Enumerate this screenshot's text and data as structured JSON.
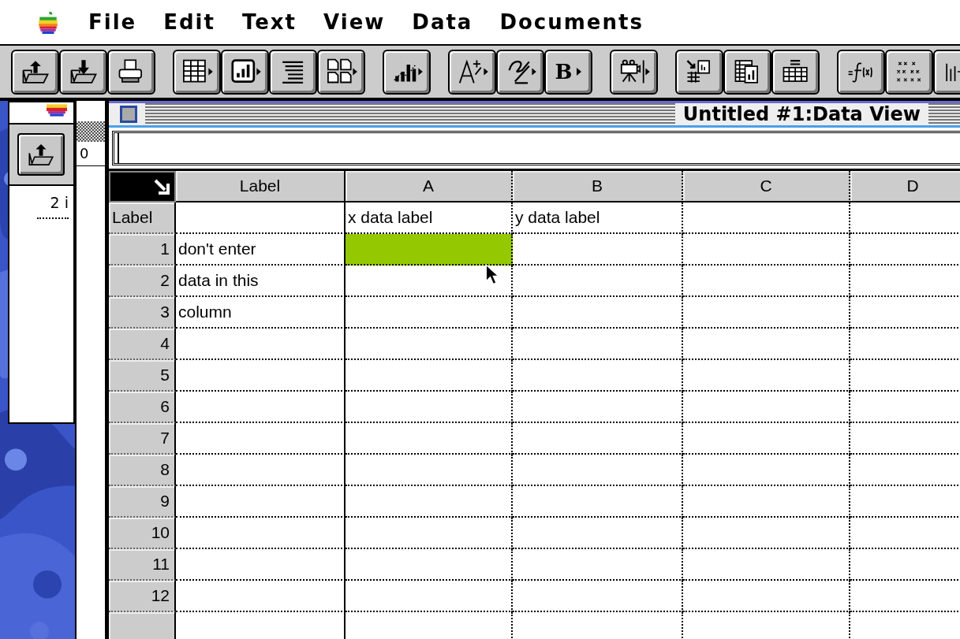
{
  "menu_bar": {
    "items": [
      "File",
      "Edit",
      "Text",
      "View",
      "Data",
      "Documents"
    ]
  },
  "toolbar": {
    "bold_button_label": "B"
  },
  "background_window": {
    "field_value": "0",
    "item_text": "2 i"
  },
  "window": {
    "title": "Untitled #1:Data View"
  },
  "table": {
    "columns": [
      "Label",
      "A",
      "B",
      "C",
      "D"
    ],
    "label_row": {
      "header": "Label",
      "x_label": "x data label",
      "y_label": "y data label"
    },
    "rows": [
      {
        "number": "1",
        "label": "don't enter",
        "cells": [
          {
            "selected": true
          },
          {
            "selected": false
          },
          {
            "selected": false
          },
          {
            "selected": false
          }
        ]
      },
      {
        "number": "2",
        "label": "data in this",
        "cells": [
          {
            "selected": false
          },
          {
            "selected": false
          },
          {
            "selected": false
          },
          {
            "selected": false
          }
        ]
      },
      {
        "number": "3",
        "label": "column",
        "cells": [
          {
            "selected": false
          },
          {
            "selected": false
          },
          {
            "selected": false
          },
          {
            "selected": false
          }
        ]
      },
      {
        "number": "4",
        "cells": [
          {
            "selected": false
          },
          {
            "selected": false
          },
          {
            "selected": false
          },
          {
            "selected": false
          }
        ]
      },
      {
        "number": "5",
        "cells": [
          {
            "selected": false
          },
          {
            "selected": false
          },
          {
            "selected": false
          },
          {
            "selected": false
          }
        ]
      },
      {
        "number": "6",
        "cells": [
          {
            "selected": false
          },
          {
            "selected": false
          },
          {
            "selected": false
          },
          {
            "selected": false
          }
        ]
      },
      {
        "number": "7",
        "cells": [
          {
            "selected": false
          },
          {
            "selected": false
          },
          {
            "selected": false
          },
          {
            "selected": false
          }
        ]
      },
      {
        "number": "8",
        "cells": [
          {
            "selected": false
          },
          {
            "selected": false
          },
          {
            "selected": false
          },
          {
            "selected": false
          }
        ]
      },
      {
        "number": "9",
        "cells": [
          {
            "selected": false
          },
          {
            "selected": false
          },
          {
            "selected": false
          },
          {
            "selected": false
          }
        ]
      },
      {
        "number": "10",
        "cells": [
          {
            "selected": false
          },
          {
            "selected": false
          },
          {
            "selected": false
          },
          {
            "selected": false
          }
        ]
      },
      {
        "number": "11",
        "cells": [
          {
            "selected": false
          },
          {
            "selected": false
          },
          {
            "selected": false
          },
          {
            "selected": false
          }
        ]
      },
      {
        "number": "12",
        "cells": [
          {
            "selected": false
          },
          {
            "selected": false
          },
          {
            "selected": false
          },
          {
            "selected": false
          }
        ]
      }
    ]
  }
}
